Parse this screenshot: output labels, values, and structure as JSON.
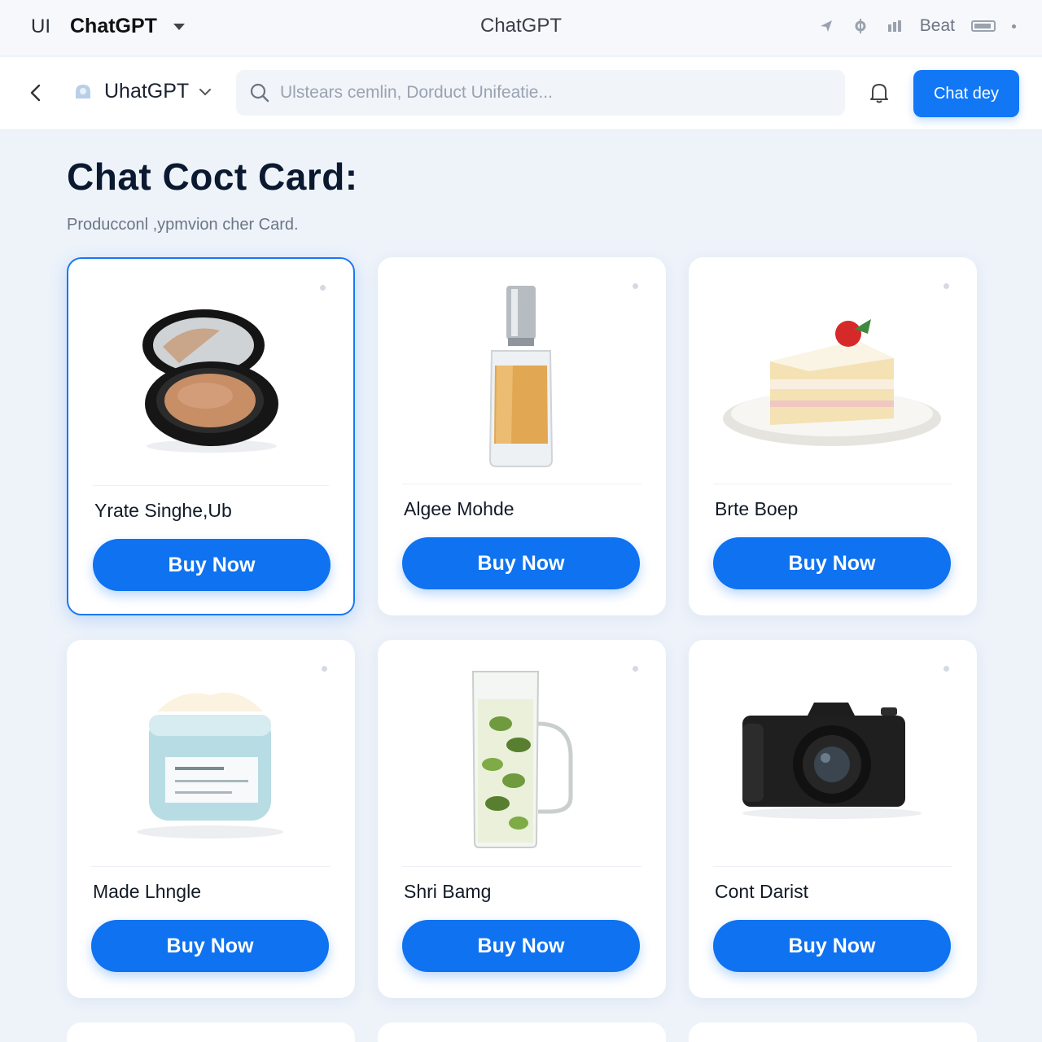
{
  "titlebar": {
    "left_label": "UI",
    "app_name": "ChatGPT",
    "center_title": "ChatGPT",
    "right_label": "Beat"
  },
  "toolbar": {
    "brand_name": "UhatGPT",
    "search_placeholder": "Ulstears cemlin, Dorduct Unifeatie...",
    "chat_button_label": "Chat dey"
  },
  "page": {
    "title": "Chat  Coct Card:",
    "subtitle": "Producconl ,ypmvion cher Card."
  },
  "products": [
    {
      "name": "Yrate Singhe,Ub",
      "button": "Buy Now",
      "image": "makeup-compact",
      "selected": true
    },
    {
      "name": "Algee Mohde",
      "button": "Buy Now",
      "image": "perfume-bottle",
      "selected": false
    },
    {
      "name": "Brte Boep",
      "button": "Buy Now",
      "image": "cake-slice",
      "selected": false
    },
    {
      "name": "Made Lhngle",
      "button": "Buy Now",
      "image": "cream-jar",
      "selected": false
    },
    {
      "name": "Shri Bamg",
      "button": "Buy Now",
      "image": "glass-pitcher",
      "selected": false
    },
    {
      "name": "Cont Darist",
      "button": "Buy Now",
      "image": "camera",
      "selected": false
    }
  ],
  "colors": {
    "accent": "#0f72f0",
    "background": "#eef3fa",
    "card": "#ffffff"
  }
}
